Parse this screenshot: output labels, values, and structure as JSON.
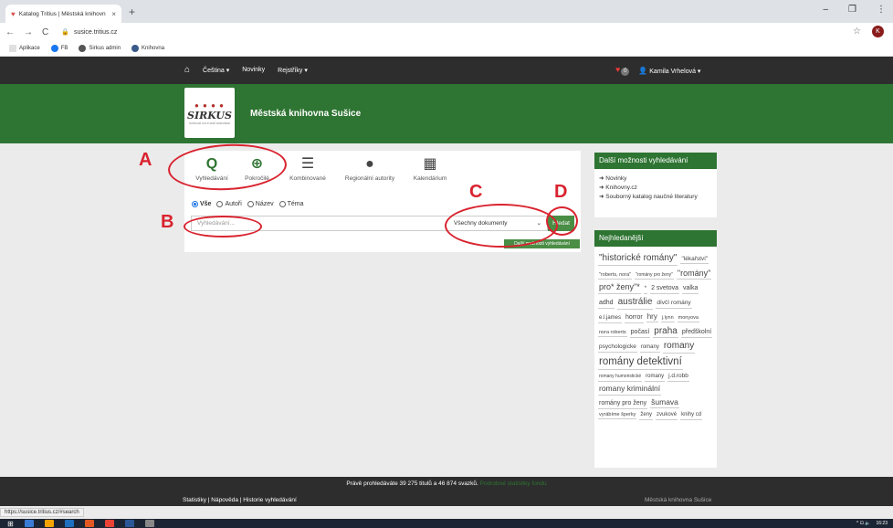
{
  "browser": {
    "tab_title": "Katalog Tritius | Městská knihovn",
    "tab_close": "×",
    "new_tab": "+",
    "window_controls": [
      "–",
      "❐",
      "⋮"
    ],
    "nav": {
      "back": "←",
      "forward": "→",
      "reload": "C"
    },
    "url": "susice.tritius.cz",
    "profile_initial": "K",
    "bookmarks": [
      {
        "label": "Aplikace",
        "color": "#e0e0e0"
      },
      {
        "label": "FB",
        "color": "#1877f2"
      },
      {
        "label": "Sirkus admin",
        "color": "#555555"
      },
      {
        "label": "Knihovna",
        "color": "#3a5a8a"
      }
    ],
    "status_url": "https://susice.tritius.cz/#search"
  },
  "topnav": {
    "language": "Čeština ▾",
    "news": "Novinky",
    "registers": "Rejstříky ▾",
    "favorites_count": "0",
    "user": "Kamila Vrhelová ▾"
  },
  "header": {
    "logo_word": "SIRKUS",
    "logo_dots": "● ● ● ●",
    "logo_tag": "SUŠICKÉ KULTURNÍ SDRUŽENÍ",
    "title": "Městská knihovna Sušice"
  },
  "search": {
    "tabs": [
      {
        "label": "Vyhledávání",
        "icon": "search-icon",
        "glyph": "Q"
      },
      {
        "label": "Pokročilé",
        "icon": "zoom-plus-icon",
        "glyph": "⊕"
      },
      {
        "label": "Kombinované",
        "icon": "stack-icon",
        "glyph": "☰"
      },
      {
        "label": "Regionální autority",
        "icon": "person-icon",
        "glyph": "●"
      },
      {
        "label": "Kalendárium",
        "icon": "calendar-icon",
        "glyph": "▦"
      }
    ],
    "scopes": [
      "Vše",
      "Autoři",
      "Název",
      "Téma"
    ],
    "selected_scope": "Vše",
    "placeholder": "Vyhledávání...",
    "doc_type": "Všechny dokumenty",
    "submit": "Hledat",
    "more": "Další možnosti vyhledávání"
  },
  "annotations": [
    "A",
    "B",
    "C",
    "D"
  ],
  "sidebar": {
    "more_title": "Další možnosti vyhledávání",
    "more_links": [
      "Novinky",
      "Knihovny.cz",
      "Souborný katalog naučné literatury"
    ],
    "popular_title": "Nejhledanější",
    "tags": [
      {
        "text": "\"historické romány\"",
        "size": 10
      },
      {
        "text": "\"lékařství\"",
        "size": 6.5
      },
      {
        "text": "\"roberts, nora\"",
        "size": 5.5
      },
      {
        "text": "\"romány pro ženy\"",
        "size": 5
      },
      {
        "text": "\"romány\"",
        "size": 9
      },
      {
        "text": "pro* ženy\"*",
        "size": 9
      },
      {
        "text": "*",
        "size": 6
      },
      {
        "text": "2 svetova",
        "size": 7
      },
      {
        "text": "valka",
        "size": 7
      },
      {
        "text": "adhd",
        "size": 7
      },
      {
        "text": "austrálie",
        "size": 10
      },
      {
        "text": "dívčí romány",
        "size": 6.5
      },
      {
        "text": "e.l.james",
        "size": 6
      },
      {
        "text": "horror",
        "size": 7
      },
      {
        "text": "hry",
        "size": 8
      },
      {
        "text": "j.lynn",
        "size": 5.5
      },
      {
        "text": "monyova",
        "size": 5.5
      },
      {
        "text": "nora roberts",
        "size": 5.5
      },
      {
        "text": "počasí",
        "size": 7
      },
      {
        "text": "praha",
        "size": 10
      },
      {
        "text": "předškolní",
        "size": 7
      },
      {
        "text": "psychologicke",
        "size": 6.5
      },
      {
        "text": "romany",
        "size": 6
      },
      {
        "text": "romany",
        "size": 10
      },
      {
        "text": "romány detektivní",
        "size": 11.5
      },
      {
        "text": "romany humoristické",
        "size": 5
      },
      {
        "text": "romany",
        "size": 6
      },
      {
        "text": "j.d.robb",
        "size": 6.5
      },
      {
        "text": "romany kriminální",
        "size": 8.5
      },
      {
        "text": "romány pro ženy",
        "size": 7
      },
      {
        "text": "šumava",
        "size": 8.5
      },
      {
        "text": "vyrábíme šperky",
        "size": 5.5
      },
      {
        "text": "ženy",
        "size": 6
      },
      {
        "text": "zvukové",
        "size": 6
      },
      {
        "text": "knihy cd",
        "size": 6
      }
    ]
  },
  "footer": {
    "stats": "Právě prohledáváte 39 275 titulů a 46 874 svazků.",
    "stats_link": "Podrobné statistiky fondu",
    "links": "Statistiky | Nápověda | Historie vyhledávání",
    "library": "Městská knihovna Sušice"
  },
  "taskbar": {
    "time": "16:23",
    "tray": "^ ⊡ 🔈",
    "apps": [
      "#3a7bd5",
      "#f4a300",
      "#1e6fbf",
      "#e25822",
      "#ea4335",
      "#2b5797",
      "#888888"
    ]
  }
}
